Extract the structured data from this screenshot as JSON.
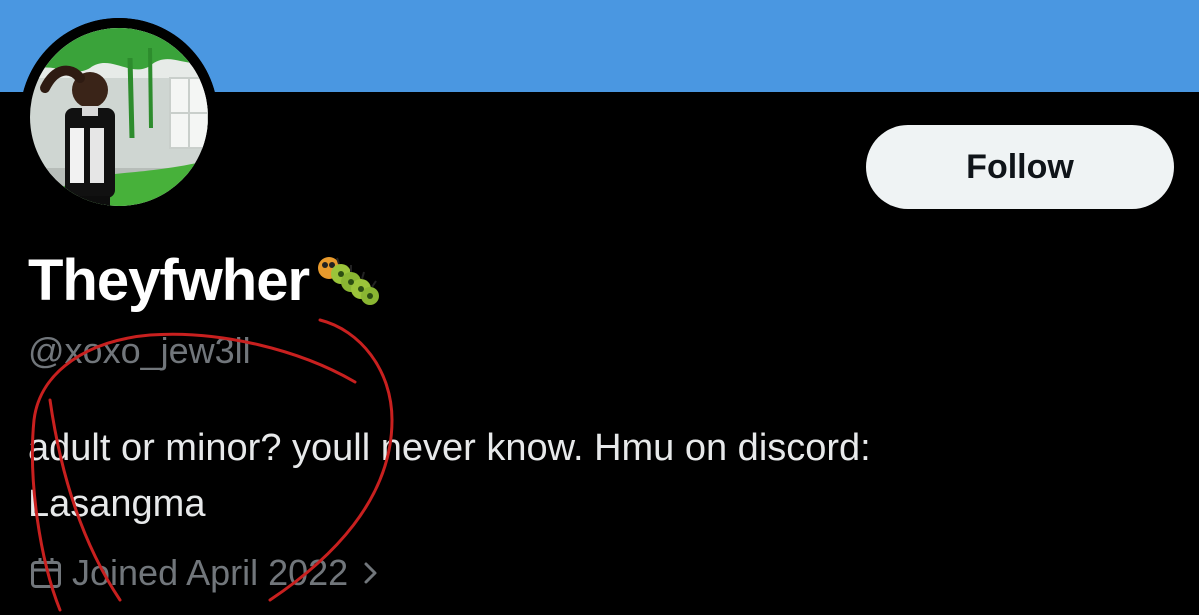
{
  "profile": {
    "display_name": "Theyfwher",
    "name_emoji": "caterpillar-emoji",
    "handle": "@xoxo_jew3ll",
    "bio_lines": [
      "adult or minor? youll never know. Hmu on discord:",
      "Lasangma"
    ],
    "joined": "Joined April 2022",
    "follow_label": "Follow",
    "avatar": "avatar-photo"
  },
  "icons": {
    "calendar": "calendar-icon",
    "chevron": "chevron-right-icon",
    "caterpillar": "caterpillar-icon"
  },
  "colors": {
    "banner": "#4a97e1",
    "background": "#000000",
    "primary_text": "#e7e9ea",
    "secondary_text": "#71767b",
    "follow_button_bg": "#eff3f4",
    "follow_button_text": "#0f1419",
    "annotation": "#c8201f"
  }
}
